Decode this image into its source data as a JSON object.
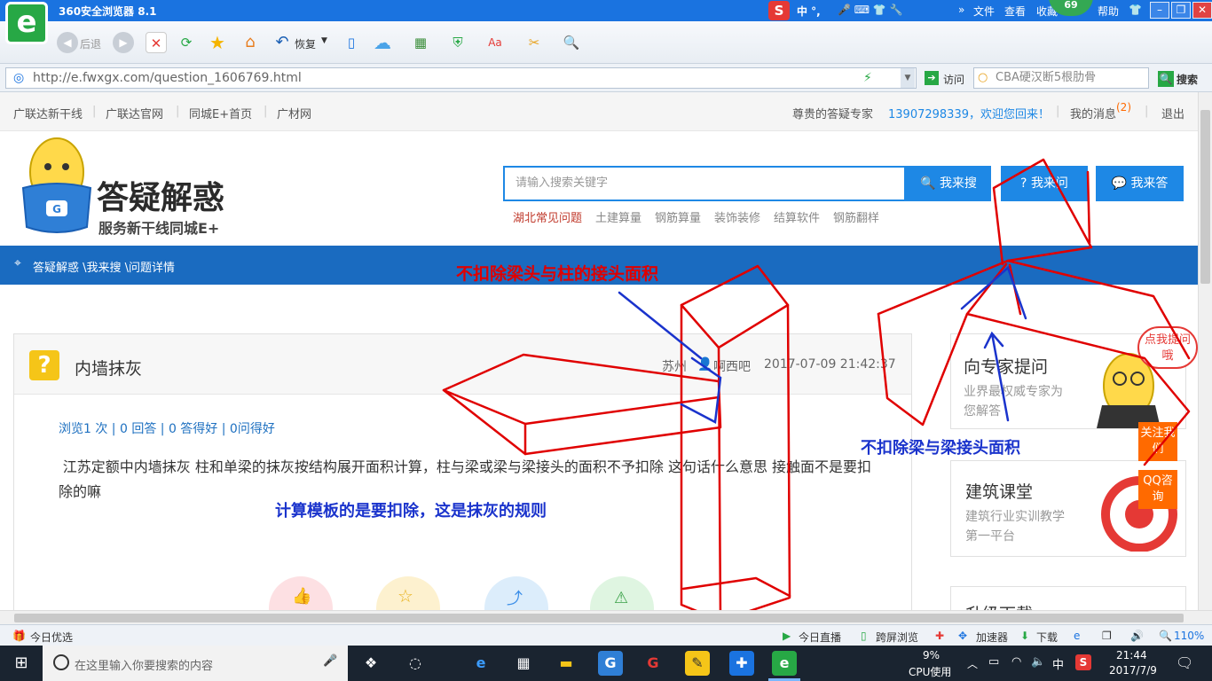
{
  "browser": {
    "title": "360安全浏览器 8.1",
    "menu": [
      "文件",
      "查看",
      "收藏",
      "帮助"
    ],
    "badge": "69",
    "ime": "中 °,",
    "toolbar": {
      "back": "后退",
      "restore": "恢复"
    },
    "url": "http://e.fwxgx.com/question_1606769.html",
    "visit": "访问",
    "search_placeholder": "CBA硬汉断5根肋骨",
    "search_button": "搜索"
  },
  "topnav": {
    "links": [
      "广联达新干线",
      "广联达官网",
      "同城E+首页",
      "广材网"
    ],
    "greeting": "尊贵的答疑专家",
    "user": "13907298339，欢迎您回来！",
    "messages": "我的消息",
    "message_count": "(2)",
    "logout": "退出"
  },
  "logo": {
    "title": "答疑解惑",
    "subtitle": "服务新干线同城E+"
  },
  "search": {
    "placeholder": "请输入搜索关键字",
    "btn_search": "我来搜",
    "btn_ask": "我来问",
    "btn_answer": "我来答",
    "hot": [
      "湖北常见问题",
      "土建算量",
      "钢筋算量",
      "装饰装修",
      "结算软件",
      "钢筋翻样"
    ]
  },
  "breadcrumb": "答疑解惑 \\我来搜 \\问题详情",
  "question": {
    "icon": "?",
    "title": "内墙抹灰",
    "author": "苏州",
    "author2": "啊西吧",
    "datetime": "2017-07-09 21:42:37",
    "stats": "浏览1 次 | 0 回答 | 0 答得好 | 0问得好",
    "body": "江苏定额中内墙抹灰  柱和单梁的抹灰按结构展开面积计算，柱与梁或梁与梁接头的面积不予扣除 这句话什么意思 接触面不是要扣除的嘛"
  },
  "sidebar": {
    "box1_title": "向专家提问",
    "box1_desc": "业界最权威专家为您解答",
    "box2_title": "建筑课堂",
    "box2_desc": "建筑行业实训教学第一平台",
    "box3_title": "升级下载",
    "float_bubble": "点我提问哦",
    "follow": "关注我们",
    "qq": "QQ咨询"
  },
  "annotations": {
    "red1": "不扣除梁头与柱的接头面积",
    "blue1": "不扣除梁与梁接头面积",
    "blue2": "计算模板的是要扣除，这是抹灰的规则"
  },
  "statusbar": {
    "left": "今日优选",
    "items": [
      "今日直播",
      "跨屏浏览",
      "加速器",
      "下载"
    ],
    "zoom": "110%"
  },
  "taskbar": {
    "search_placeholder": "在这里输入你要搜索的内容",
    "cpu": "9%",
    "cpu_label": "CPU使用",
    "ime": "中",
    "time": "21:44",
    "date": "2017/7/9"
  },
  "colors": {
    "brand_blue": "#1a6bc0",
    "accent_blue": "#1e88e5",
    "annot_red": "#e00000",
    "annot_blue": "#1a33cc",
    "orange": "#ff6a00"
  }
}
